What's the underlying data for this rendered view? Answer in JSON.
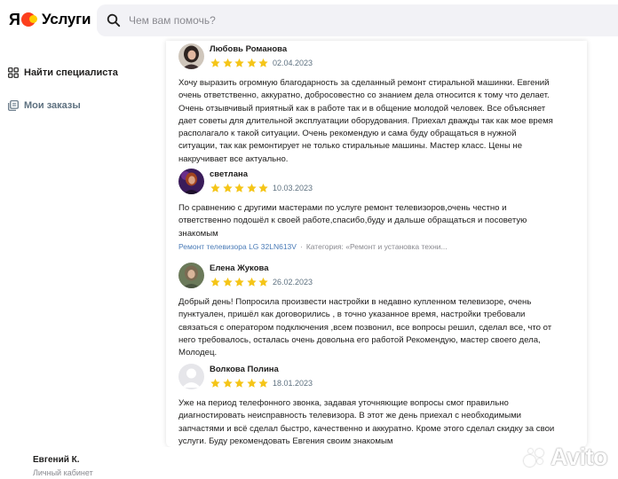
{
  "header": {
    "logo_letter": "Я",
    "brand": "Услуги",
    "search_placeholder": "Чем вам помочь?"
  },
  "sidebar": {
    "items": [
      {
        "label": "Найти специалиста",
        "icon": "grid-icon"
      },
      {
        "label": "Мои заказы",
        "icon": "orders-icon"
      }
    ]
  },
  "user": {
    "name": "Евгений К.",
    "subtitle": "Личный кабинет"
  },
  "reviews": [
    {
      "name": "Любовь Романова",
      "rating": 5,
      "date": "02.04.2023",
      "lines": [
        "Хочу выразить огромную благодарность за сделанный ремонт стиральной машинки. Евгений",
        "очень ответственно, аккуратно, добросовестно со знанием дела относится к тому что делает.",
        "Очень отзывчивый приятный как в работе так и в общение молодой человек. Все объясняет",
        "дает советы для длительной эксплуатации оборудования. Приехал дважды так как мое время",
        "располагало к такой ситуации. Очень рекомендую и сама буду обращаться в нужной",
        "ситуации, так как ремонтирует не только стиральные машины. Мастер класс. Цены не",
        "накручивает все актуально."
      ],
      "service": "",
      "category": ""
    },
    {
      "name": "светлана",
      "rating": 5,
      "date": "10.03.2023",
      "lines": [
        "По сравнению с другими мастерами по услуге ремонт телевизоров,очень честно и",
        "ответственно подошёл к своей работе,спасибо,буду и дальше обращаться и посоветую",
        "знакомым"
      ],
      "service": "Ремонт телевизора LG 32LN613V",
      "category": "Категория: «Ремонт и установка техни..."
    },
    {
      "name": "Елена Жукова",
      "rating": 5,
      "date": "26.02.2023",
      "lines": [
        "Добрый день! Попросила произвести настройки в недавно купленном телевизоре, очень",
        "пунктуален, пришёл как договорились , в точно указанное время, настройки требовали",
        "связаться с оператором подключения ,всем позвонил, все вопросы решил, сделал все, что от",
        "него требовалось, осталась очень довольна его работой Рекомендую, мастер своего дела,",
        "Молодец."
      ],
      "service": "",
      "category": ""
    },
    {
      "name": "Волкова Полина",
      "rating": 5,
      "date": "18.01.2023",
      "lines": [
        "Уже на период телефонного звонка, задавая уточняющие вопросы смог правильно",
        "диагностировать неисправность телевизора. В этот же день приехал с необходимыми",
        "запчастями и всё сделал быстро, качественно и аккуратно. Кроме этого сделал скидку за свои",
        "услуги. Буду рекомендовать Евгения своим знакомым"
      ],
      "service": "",
      "category": ""
    }
  ],
  "watermark": "Avito",
  "colors": {
    "star": "#f5c518",
    "link": "#4a7bb7",
    "search_bg": "#f2f2f6",
    "muted": "#8a8a90"
  }
}
